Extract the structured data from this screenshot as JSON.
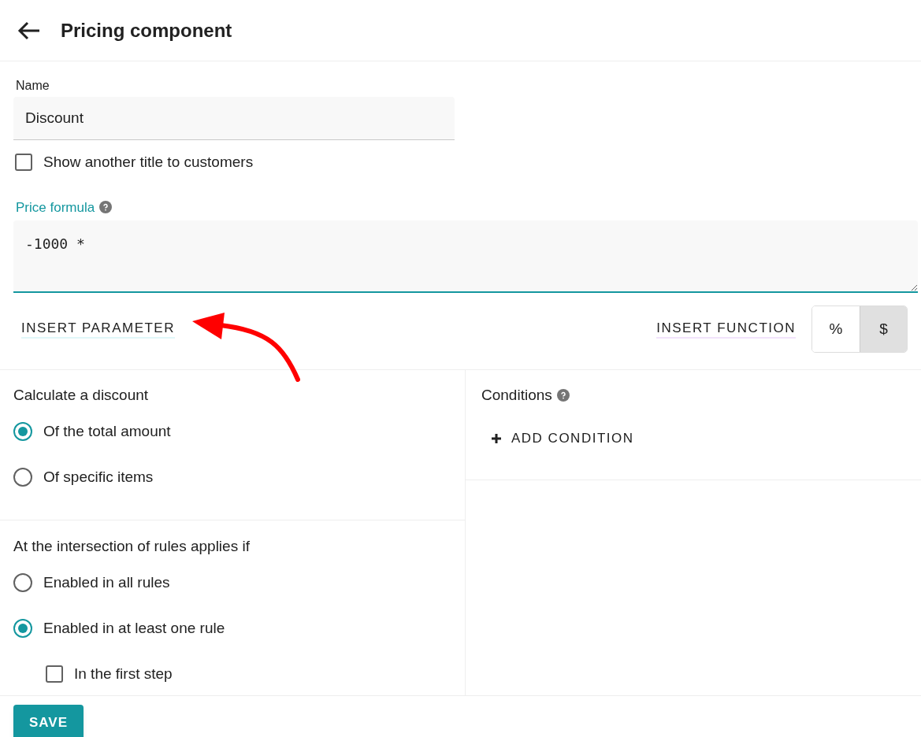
{
  "header": {
    "title": "Pricing component"
  },
  "name_field": {
    "label": "Name",
    "value": "Discount"
  },
  "alt_title": {
    "label": "Show another title to customers",
    "checked": false
  },
  "price_formula": {
    "label": "Price formula",
    "value": "-1000 *"
  },
  "insert_parameter": "INSERT PARAMETER",
  "insert_function": "INSERT FUNCTION",
  "unit_toggle": [
    {
      "label": "%",
      "selected": false
    },
    {
      "label": "$",
      "selected": true
    }
  ],
  "discount_basis": {
    "title": "Calculate a discount",
    "options": [
      {
        "label": "Of the total amount",
        "selected": true
      },
      {
        "label": "Of specific items",
        "selected": false
      }
    ]
  },
  "intersection": {
    "title": "At the intersection of rules applies if",
    "options": [
      {
        "label": "Enabled in all rules",
        "selected": false
      },
      {
        "label": "Enabled in at least one rule",
        "selected": true
      }
    ],
    "first_step": {
      "label": "In the first step",
      "checked": false
    }
  },
  "conditions": {
    "title": "Conditions",
    "add_button": "ADD CONDITION"
  },
  "save_button": "SAVE"
}
